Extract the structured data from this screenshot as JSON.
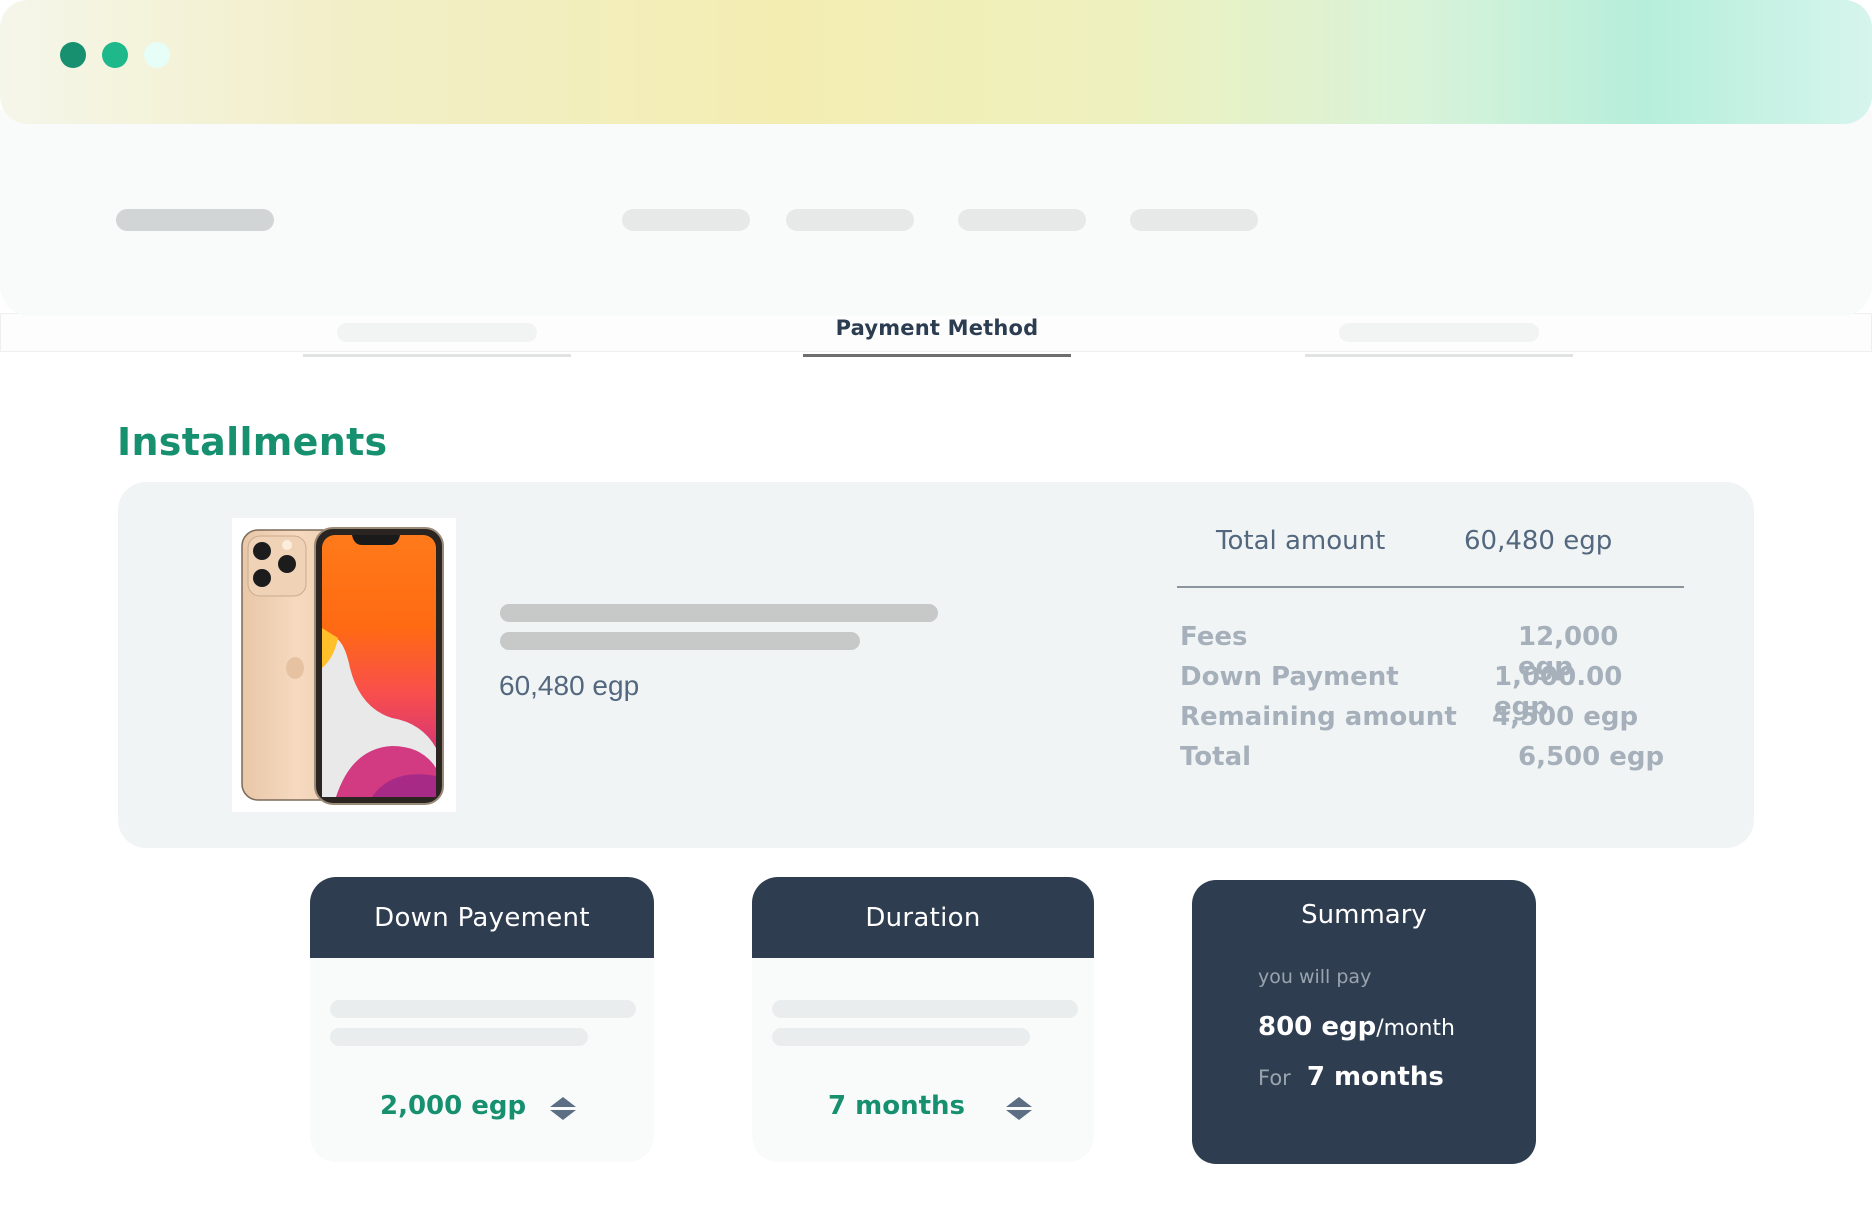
{
  "window": {
    "controls": [
      {
        "name": "close",
        "color": "#17906f"
      },
      {
        "name": "minimize",
        "color": "#1eb88b"
      },
      {
        "name": "maximize",
        "color": "#e6fdf8"
      }
    ]
  },
  "tabs": [
    {
      "label": "",
      "active": false
    },
    {
      "label": "Payment Method",
      "active": true
    },
    {
      "label": "",
      "active": false
    }
  ],
  "section": {
    "title": "Installments"
  },
  "product": {
    "image": "iphone-product-image",
    "price": "60,480 egp"
  },
  "totals": {
    "label": "Total amount",
    "value": "60,480 egp",
    "breakdown": [
      {
        "label": "Fees",
        "value": "12,000 egp"
      },
      {
        "label": "Down Payment",
        "value": "1,000.00 egp"
      },
      {
        "label": "Remaining amount",
        "value": "4,500 egp"
      },
      {
        "label": "Total",
        "value": "6,500 egp"
      }
    ]
  },
  "down_payment": {
    "title": "Down Payement",
    "value": "2,000 egp",
    "icon": "stepper-icon"
  },
  "duration": {
    "title": "Duration",
    "value": "7 months",
    "icon": "stepper-icon"
  },
  "summary": {
    "title": "Summary",
    "subtitle": "you will pay",
    "amount": "800 egp",
    "per": "/month",
    "for_label": "For",
    "duration": "7 months"
  },
  "colors": {
    "accent": "#17906f",
    "dark": "#2e3d50",
    "muted": "#a6b0bb"
  }
}
